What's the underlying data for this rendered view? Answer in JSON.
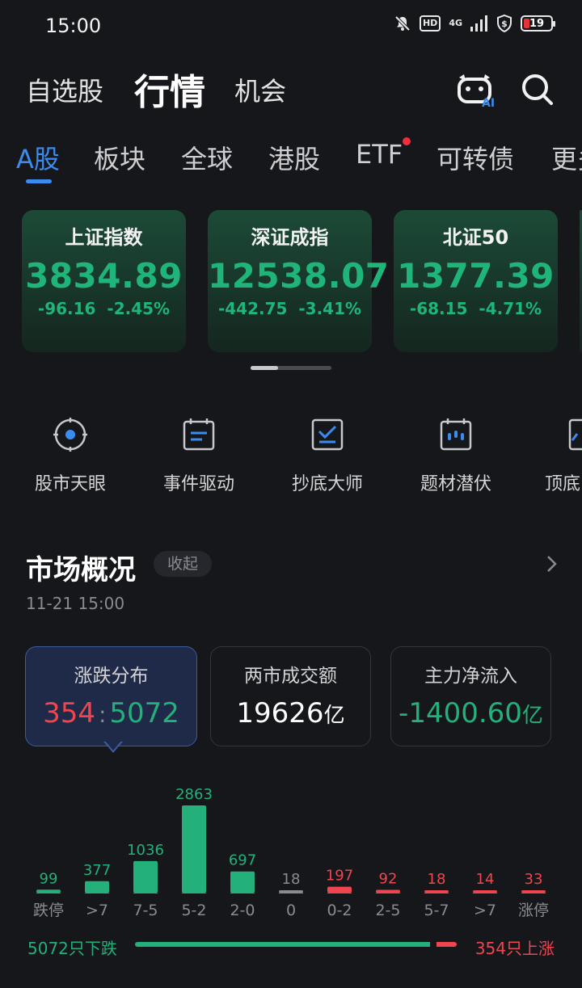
{
  "status_bar": {
    "time": "15:00",
    "hd": "HD",
    "network": "4G",
    "battery": "19"
  },
  "header": {
    "tabs": [
      {
        "label": "自选股"
      },
      {
        "label": "行情"
      },
      {
        "label": "机会"
      }
    ],
    "ai_label": "AI"
  },
  "market_tabs": [
    {
      "label": "A股"
    },
    {
      "label": "板块"
    },
    {
      "label": "全球"
    },
    {
      "label": "港股"
    },
    {
      "label": "ETF"
    },
    {
      "label": "可转债"
    },
    {
      "label": "更多"
    }
  ],
  "index_cards": [
    {
      "name": "上证指数",
      "value": "3834.89",
      "change": "-96.16",
      "percent": "-2.45%"
    },
    {
      "name": "深证成指",
      "value": "12538.07",
      "change": "-442.75",
      "percent": "-3.41%"
    },
    {
      "name": "北证50",
      "value": "1377.39",
      "change": "-68.15",
      "percent": "-4.71%"
    }
  ],
  "tools": [
    {
      "label": "股市天眼"
    },
    {
      "label": "事件驱动"
    },
    {
      "label": "抄底大师"
    },
    {
      "label": "题材潜伏"
    },
    {
      "label": "顶底"
    }
  ],
  "overview": {
    "title": "市场概况",
    "collapse": "收起",
    "timestamp": "11-21  15:00",
    "stats": {
      "distribution": {
        "label": "涨跌分布",
        "rise": "354",
        "sep": ":",
        "fall": "5072"
      },
      "turnover": {
        "label": "两市成交额",
        "value": "19626",
        "unit": "亿"
      },
      "net_inflow": {
        "label": "主力净流入",
        "value": "-1400.60",
        "unit": "亿"
      }
    },
    "summary": {
      "fall": "5072只下跌",
      "rise": "354只上涨",
      "fall_count": 5072,
      "rise_count": 354
    }
  },
  "chart_data": {
    "type": "bar",
    "title": "",
    "categories": [
      "跌停",
      ">7",
      "7-5",
      "5-2",
      "2-0",
      "0",
      "0-2",
      "2-5",
      "5-7",
      ">7",
      "涨停"
    ],
    "values": [
      99,
      377,
      1036,
      2863,
      697,
      18,
      197,
      92,
      18,
      14,
      33
    ],
    "colors": [
      "#23b07a",
      "#23b07a",
      "#23b07a",
      "#23b07a",
      "#23b07a",
      "#8a8b90",
      "#f0454f",
      "#f0454f",
      "#f0454f",
      "#f0454f",
      "#f0454f"
    ],
    "xlabel": "",
    "ylabel": "",
    "grid": false
  }
}
